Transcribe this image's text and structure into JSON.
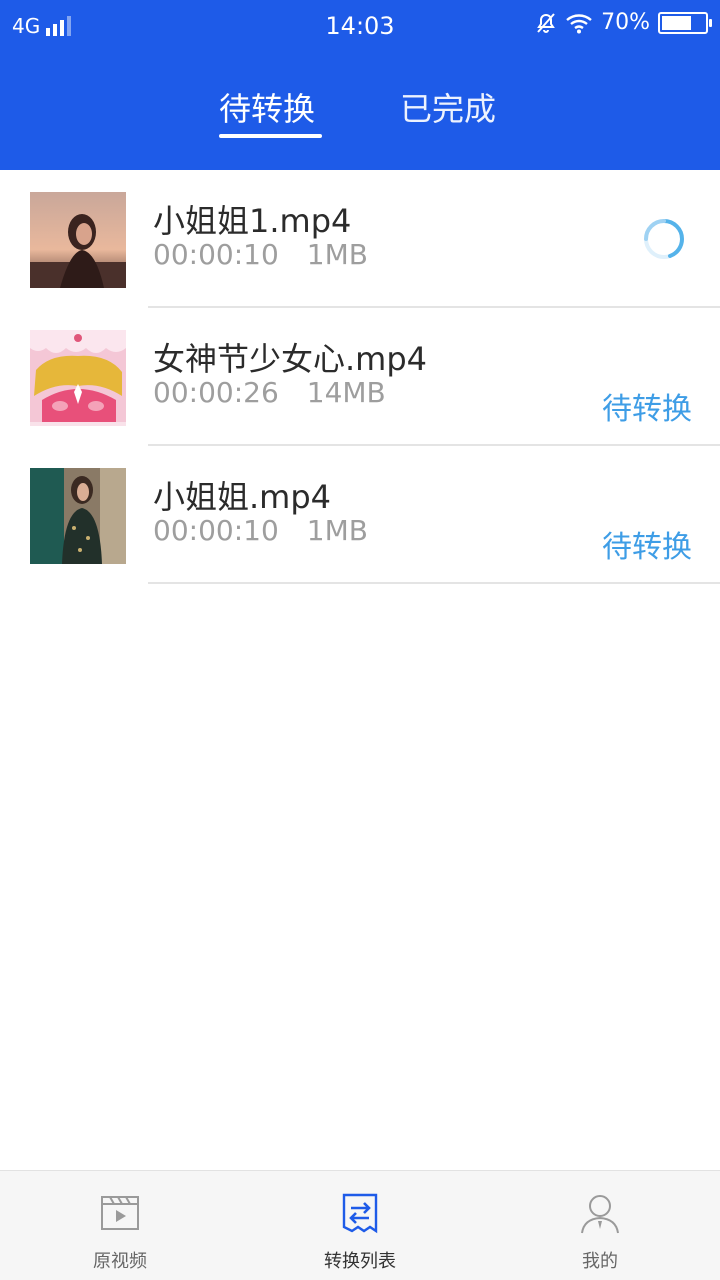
{
  "status_bar": {
    "network": "4G",
    "time": "14:03",
    "battery": "70%",
    "battery_level": 0.7
  },
  "tabs": [
    {
      "label": "待转换",
      "active": true
    },
    {
      "label": "已完成",
      "active": false
    }
  ],
  "items": [
    {
      "name": "小姐姐1.mp4",
      "duration": "00:00:10",
      "size": "1MB",
      "status": "",
      "state": "converting"
    },
    {
      "name": "女神节少女心.mp4",
      "duration": "00:00:26",
      "size": "14MB",
      "status": "待转换",
      "state": "pending"
    },
    {
      "name": "小姐姐.mp4",
      "duration": "00:00:10",
      "size": "1MB",
      "status": "待转换",
      "state": "pending"
    }
  ],
  "bottom_nav": [
    {
      "label": "原视频",
      "icon": "video-icon",
      "active": false
    },
    {
      "label": "转换列表",
      "icon": "convert-list-icon",
      "active": true
    },
    {
      "label": "我的",
      "icon": "user-icon",
      "active": false
    }
  ],
  "colors": {
    "header": "#1e5be8",
    "accent": "#3e9de6",
    "nav_active": "#1e5be8"
  }
}
